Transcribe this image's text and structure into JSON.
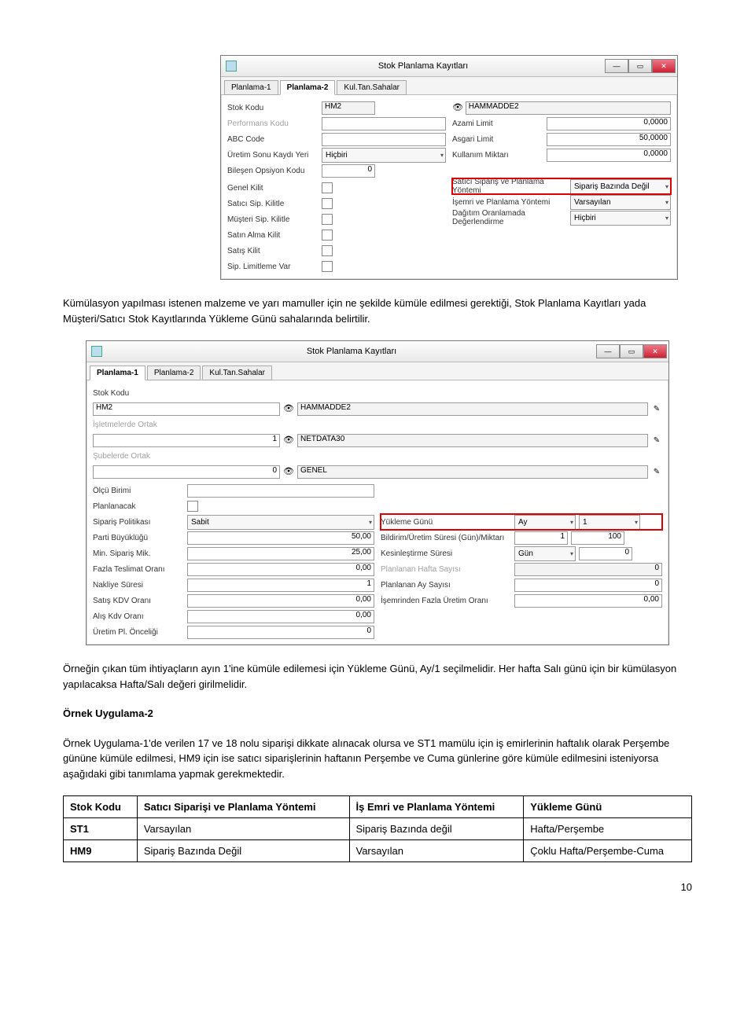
{
  "win1": {
    "title": "Stok Planlama Kayıtları",
    "tabs": [
      "Planlama-1",
      "Planlama-2",
      "Kul.Tan.Sahalar"
    ],
    "active_tab": 1,
    "left": {
      "stok_kodu_lbl": "Stok Kodu",
      "stok_kodu_val": "HM2",
      "perf_lbl": "Performans Kodu",
      "abc_lbl": "ABC Code",
      "uretim_lbl": "Üretim Sonu Kaydı Yeri",
      "uretim_val": "Hiçbiri",
      "bilesen_lbl": "Bileşen Opsiyon Kodu",
      "bilesen_val": "0",
      "genel_lbl": "Genel Kilit",
      "satici_lbl": "Satıcı Sip. Kilitle",
      "musteri_lbl": "Müşteri Sip. Kilitle",
      "satinalma_lbl": "Satın Alma Kilit",
      "satis_lbl": "Satış Kilit",
      "siplim_lbl": "Sip. Limitleme Var"
    },
    "right": {
      "hammadde": "HAMMADDE2",
      "azami_lbl": "Azami Limit",
      "azami_val": "0,0000",
      "asgari_lbl": "Asgari Limit",
      "asgari_val": "50,0000",
      "kullanim_lbl": "Kullanım Miktarı",
      "kullanim_val": "0,0000",
      "satici_plan_lbl": "Satıcı Sipariş ve Planlama Yöntemi",
      "satici_plan_val": "Sipariş Bazında Değil",
      "isemri_lbl": "İşemri ve Planlama Yöntemi",
      "isemri_val": "Varsayılan",
      "dagitim_lbl": "Dağıtım Oranlamada Değerlendirme",
      "dagitim_val": "Hiçbiri"
    }
  },
  "para1": "Kümülasyon yapılması istenen malzeme ve yarı mamuller için ne şekilde kümüle edilmesi gerektiği, Stok Planlama Kayıtları yada Müşteri/Satıcı Stok Kayıtlarında Yükleme Günü sahalarında belirtilir.",
  "win2": {
    "title": "Stok Planlama Kayıtları",
    "tabs": [
      "Planlama-1",
      "Planlama-2",
      "Kul.Tan.Sahalar"
    ],
    "active_tab": 0,
    "left": {
      "stok_lbl": "Stok Kodu",
      "stok_val": "HM2",
      "isl_lbl": "İşletmelerde Ortak",
      "isl_num": "1",
      "isl_txt": "NETDATA30",
      "sub_lbl": "Şubelerde Ortak",
      "sub_num": "0",
      "sub_txt": "GENEL",
      "olcu_lbl": "Ölçü Birimi",
      "plan_lbl": "Planlanacak",
      "siparis_lbl": "Sipariş Politikası",
      "siparis_val": "Sabit",
      "parti_lbl": "Parti Büyüklüğü",
      "parti_val": "50,00",
      "min_lbl": "Min. Sipariş Mik.",
      "min_val": "25,00",
      "fazla_lbl": "Fazla Teslimat Oranı",
      "fazla_val": "0,00",
      "nak_lbl": "Nakliye Süresi",
      "nak_val": "1",
      "skdv_lbl": "Satış KDV Oranı",
      "skdv_val": "0,00",
      "akdv_lbl": "Alış Kdv Oranı",
      "akdv_val": "0,00",
      "upl_lbl": "Üretim Pl. Önceliği",
      "upl_val": "0"
    },
    "right": {
      "hammadde": "HAMMADDE2",
      "yuk_lbl": "Yükleme Günü",
      "yuk_sel1": "Ay",
      "yuk_sel2": "1",
      "bild_lbl": "Bildirim/Üretim Süresi (Gün)/Miktarı",
      "bild_v1": "1",
      "bild_v2": "100",
      "kes_lbl": "Kesinleştirme Süresi",
      "kes_sel": "Gün",
      "kes_val": "0",
      "phs_lbl": "Planlanan Hafta Sayısı",
      "phs_val": "0",
      "pas_lbl": "Planlanan Ay Sayısı",
      "pas_val": "0",
      "ife_lbl": "İşemrinden Fazla Üretim Oranı",
      "ife_val": "0,00"
    }
  },
  "para2_a": "Örneğin çıkan tüm ihtiyaçların ayın 1'ine kümüle edilemesi için Yükleme Günü, Ay/1 seçilmelidir. Her hafta Salı günü için bir kümülasyon yapılacaksa Hafta/Salı değeri girilmelidir.",
  "h2": "Örnek Uygulama-2",
  "para2_b": "Örnek Uygulama-1'de verilen 17 ve 18 nolu siparişi dikkate alınacak olursa ve  ST1 mamülu için iş emirlerinin haftalık olarak Perşembe gününe kümüle edilmesi, HM9 için ise satıcı siparişlerinin haftanın Perşembe ve Cuma günlerine göre kümüle edilmesini isteniyorsa aşağıdaki gibi tanımlama yapmak gerekmektedir.",
  "table": {
    "h": [
      "Stok Kodu",
      "Satıcı Siparişi ve Planlama Yöntemi",
      "İş Emri ve Planlama Yöntemi",
      "Yükleme Günü"
    ],
    "r1": [
      "ST1",
      "Varsayılan",
      "Sipariş Bazında değil",
      "Hafta/Perşembe"
    ],
    "r2": [
      "HM9",
      "Sipariş Bazında Değil",
      "Varsayılan",
      "Çoklu Hafta/Perşembe-Cuma"
    ]
  },
  "pagenum": "10"
}
